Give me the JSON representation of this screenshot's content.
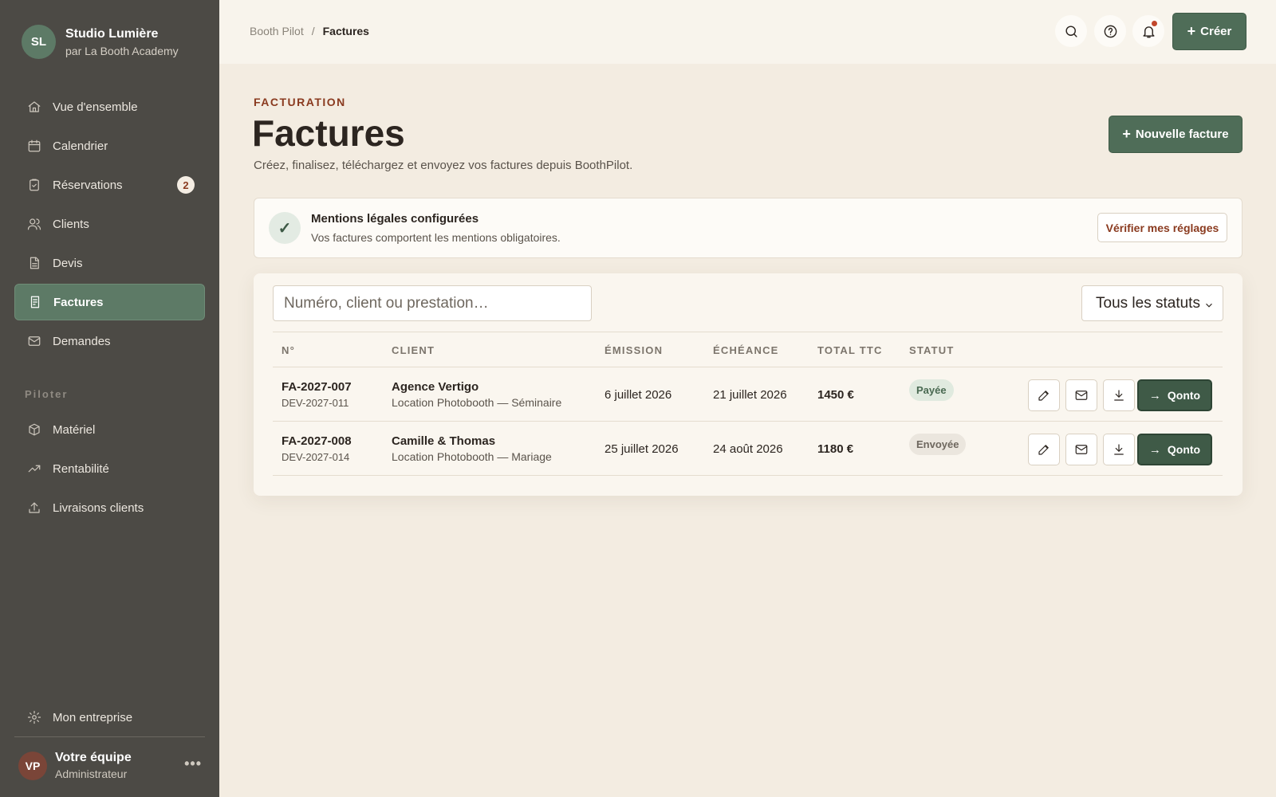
{
  "brand": {
    "initials": "SL",
    "name": "Studio Lumière",
    "subtitle": "par La Booth Academy"
  },
  "nav": {
    "items": [
      {
        "label": "Vue d'ensemble",
        "icon": "home-icon"
      },
      {
        "label": "Calendrier",
        "icon": "calendar-icon"
      },
      {
        "label": "Réservations",
        "icon": "clipboard-check-icon",
        "badge": "2"
      },
      {
        "label": "Clients",
        "icon": "users-icon"
      },
      {
        "label": "Devis",
        "icon": "document-icon"
      },
      {
        "label": "Factures",
        "icon": "receipt-icon",
        "active": true
      },
      {
        "label": "Demandes",
        "icon": "mail-icon"
      }
    ],
    "section_label": "Piloter",
    "section_items": [
      {
        "label": "Matériel",
        "icon": "box-icon"
      },
      {
        "label": "Rentabilité",
        "icon": "trend-up-icon"
      },
      {
        "label": "Livraisons clients",
        "icon": "upload-icon"
      }
    ],
    "settings_label": "Mon entreprise"
  },
  "user": {
    "initials": "VP",
    "name": "Votre équipe",
    "role": "Administrateur",
    "more": "•••"
  },
  "topbar": {
    "breadcrumb": [
      "Booth Pilot",
      "Factures"
    ],
    "breadcrumb_sep": "/",
    "create_label": "Créer"
  },
  "header": {
    "eyebrow": "FACTURATION",
    "title": "Factures",
    "subtitle": "Créez, finalisez, téléchargez et envoyez vos factures depuis BoothPilot.",
    "new_invoice_label": "Nouvelle facture"
  },
  "notice": {
    "check": "✓",
    "title": "Mentions légales configurées",
    "text": "Vos factures comportent les mentions obligatoires.",
    "button": "Vérifier mes réglages"
  },
  "filters": {
    "search_placeholder": "Numéro, client ou prestation…",
    "status_value": "Tous les statuts"
  },
  "table": {
    "columns": [
      "N°",
      "CLIENT",
      "ÉMISSION",
      "ÉCHÉANCE",
      "TOTAL TTC",
      "STATUT"
    ],
    "rows": [
      {
        "number": "FA-2027-007",
        "quote": "DEV-2027-011",
        "client": "Agence Vertigo",
        "service": "Location Photobooth — Séminaire",
        "issued": "6 juillet 2026",
        "due": "21 juillet 2026",
        "total": "1450 €",
        "status": "Payée",
        "status_type": "paid",
        "action": "Qonto"
      },
      {
        "number": "FA-2027-008",
        "quote": "DEV-2027-014",
        "client": "Camille & Thomas",
        "service": "Location Photobooth — Mariage",
        "issued": "25 juillet 2026",
        "due": "24 août 2026",
        "total": "1180 €",
        "status": "Envoyée",
        "status_type": "sent",
        "action": "Qonto"
      }
    ]
  },
  "colors": {
    "accent": "#4f6d58",
    "sidebar": "#4c4a45",
    "eyebrow": "#8a3a1f",
    "background": "#f3ece1"
  }
}
